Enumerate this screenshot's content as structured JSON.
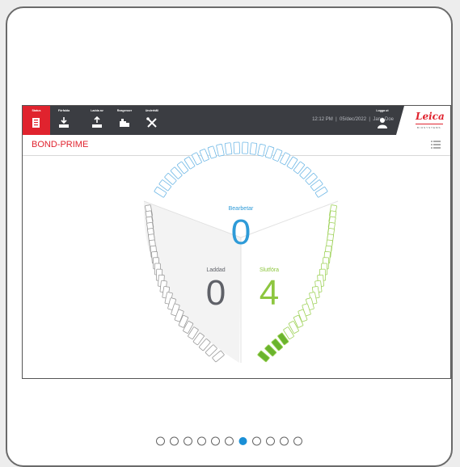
{
  "nav": {
    "items": [
      {
        "label": "Status",
        "icon": "status-icon"
      },
      {
        "label": "Förfalda",
        "icon": "tray-icon"
      },
      {
        "label": "Ladda av",
        "icon": "unload-icon"
      },
      {
        "label": "Reagenser",
        "icon": "reagent-icon"
      },
      {
        "label": "Underhåll",
        "icon": "tools-icon"
      }
    ],
    "active": "Status"
  },
  "status_bar": {
    "time": "12:12 PM",
    "date": "05/dec/2022",
    "user": "Jane Doe",
    "separator": "|"
  },
  "logout_label": "Logga ut",
  "brand": {
    "logo": "Leica",
    "sub": "BIOSYSTEMS"
  },
  "page_title": "BOND-PRIME",
  "gauge": {
    "processing": {
      "label": "Bearbetar",
      "value": "0",
      "color": "#2e9bd8"
    },
    "loaded": {
      "label": "Laddad",
      "value": "0",
      "color": "#5f6168"
    },
    "complete": {
      "label": "Slutföra",
      "value": "4",
      "color": "#8dc63f"
    }
  },
  "pagination": {
    "count": 11,
    "active_index": 6
  },
  "colors": {
    "accent": "#e0232e",
    "topbar": "#3b3d42"
  }
}
